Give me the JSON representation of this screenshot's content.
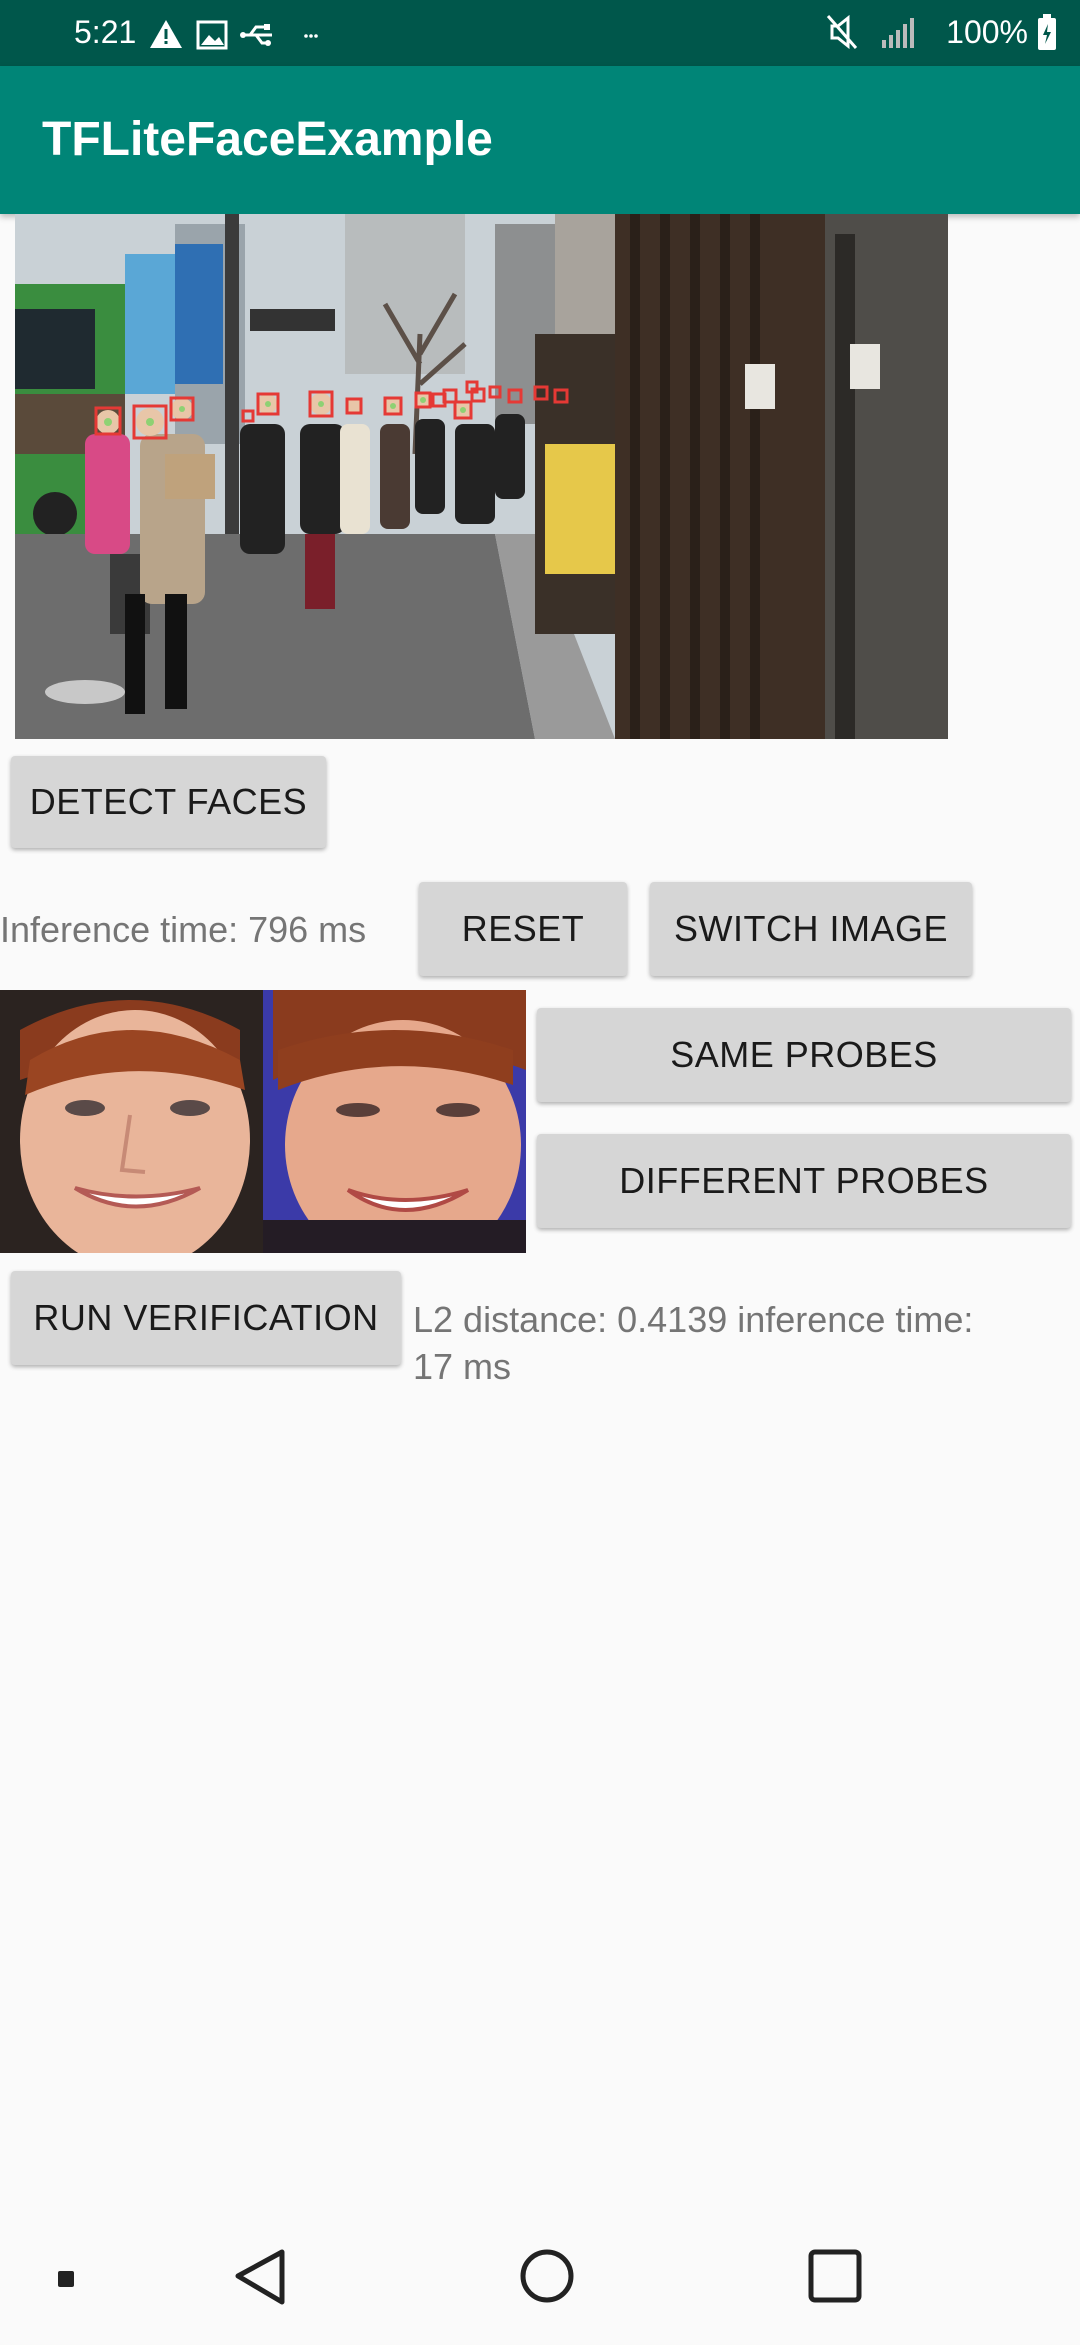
{
  "status_bar": {
    "time": "5:21",
    "battery": "100%"
  },
  "app_bar": {
    "title": "TFLiteFaceExample"
  },
  "detection": {
    "detect_button": "DETECT FACES",
    "inference_time_text": "Inference time: 796 ms",
    "reset_button": "RESET",
    "switch_image_button": "SWITCH IMAGE"
  },
  "verification": {
    "same_probes_button": "SAME PROBES",
    "different_probes_button": "DIFFERENT PROBES",
    "run_button": "RUN VERIFICATION",
    "result_line1": "L2 distance: 0.4139 inference time:",
    "result_line2": "17 ms"
  },
  "colors": {
    "status_bar": "#00574b",
    "app_bar": "#008577",
    "button": "#d6d6d6",
    "face_box": "#e53935"
  },
  "icons": {
    "status_left": [
      "warning-icon",
      "image-icon",
      "usb-icon",
      "more-icon"
    ],
    "status_right": [
      "mute-icon",
      "signal-icon",
      "battery-icon"
    ],
    "nav": [
      "dot-icon",
      "back-icon",
      "home-icon",
      "recents-icon"
    ]
  }
}
